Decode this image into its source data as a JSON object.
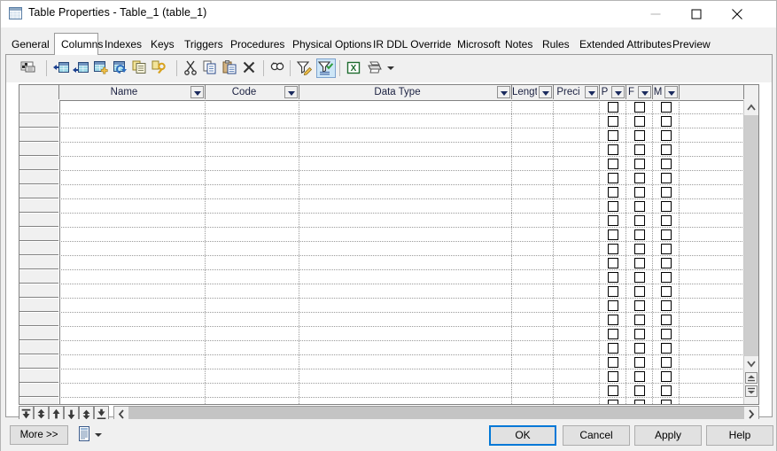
{
  "window": {
    "title": "Table Properties - Table_1 (table_1)",
    "icon": "table-icon",
    "minimize_label": "—",
    "maximize_label": "□",
    "close_label": "✕"
  },
  "tabs": [
    {
      "label": "General",
      "selected": false
    },
    {
      "label": "Columns",
      "selected": true
    },
    {
      "label": "Indexes",
      "selected": false
    },
    {
      "label": "Keys",
      "selected": false
    },
    {
      "label": "Triggers",
      "selected": false
    },
    {
      "label": "Procedures",
      "selected": false
    },
    {
      "label": "Physical Options",
      "selected": false
    },
    {
      "label": "IR DDL Override",
      "selected": false
    },
    {
      "label": "Microsoft",
      "selected": false
    },
    {
      "label": "Notes",
      "selected": false
    },
    {
      "label": "Rules",
      "selected": false
    },
    {
      "label": "Extended Attributes",
      "selected": false
    },
    {
      "label": "Preview",
      "selected": false
    }
  ],
  "toolbar": {
    "buttons": [
      {
        "name": "properties-icon",
        "active": false
      },
      {
        "name": "insert-row-icon",
        "active": false
      },
      {
        "name": "add-row-icon",
        "active": false
      },
      {
        "name": "add-object-icon",
        "active": false
      },
      {
        "name": "replace-object-icon",
        "active": false
      },
      {
        "name": "duplicate-icon",
        "active": false
      },
      {
        "name": "delete-key-icon",
        "active": false
      },
      {
        "name": "cut-icon",
        "active": false
      },
      {
        "name": "copy-icon",
        "active": false
      },
      {
        "name": "paste-icon",
        "active": false
      },
      {
        "name": "delete-icon",
        "active": false
      },
      {
        "name": "find-icon",
        "active": false
      },
      {
        "name": "customize-filter-icon",
        "active": false
      },
      {
        "name": "apply-filter-icon",
        "active": true
      },
      {
        "name": "export-excel-icon",
        "active": false
      },
      {
        "name": "print-icon",
        "active": false
      }
    ],
    "print_dropdown": "dropdown-arrow"
  },
  "grid": {
    "columns": [
      {
        "label": "",
        "name": "row-selector",
        "filter": false
      },
      {
        "label": "Name",
        "name": "column-name",
        "filter": true
      },
      {
        "label": "Code",
        "name": "column-code",
        "filter": true
      },
      {
        "label": "Data Type",
        "name": "column-data-type",
        "filter": true
      },
      {
        "label": "Lengt",
        "name": "column-length",
        "filter": true
      },
      {
        "label": "Preci",
        "name": "column-precision",
        "filter": true
      },
      {
        "label": "P",
        "name": "column-primary",
        "filter": true
      },
      {
        "label": "F",
        "name": "column-foreign",
        "filter": true
      },
      {
        "label": "M",
        "name": "column-mandatory",
        "filter": true
      },
      {
        "label": "",
        "name": "column-filler",
        "filter": false
      }
    ],
    "rows": [],
    "row_count": 22,
    "empty": true,
    "nav_buttons": [
      {
        "name": "move-to-top-button",
        "glyph": "top"
      },
      {
        "name": "move-up-fast-button",
        "glyph": "up-double"
      },
      {
        "name": "move-up-button",
        "glyph": "up"
      },
      {
        "name": "move-down-button",
        "glyph": "down"
      },
      {
        "name": "move-down-fast-button",
        "glyph": "down-double"
      },
      {
        "name": "move-to-bottom-button",
        "glyph": "bottom"
      }
    ]
  },
  "footer": {
    "more_label": "More >>",
    "print_icon": "report-icon",
    "ok_label": "OK",
    "cancel_label": "Cancel",
    "apply_label": "Apply",
    "help_label": "Help"
  },
  "colors": {
    "accent": "#0078d7",
    "toolbar_active": "#cde6f7",
    "window_bg": "#f0f0f0",
    "panel_bg": "#ffffff",
    "header_text": "#1a2040"
  }
}
